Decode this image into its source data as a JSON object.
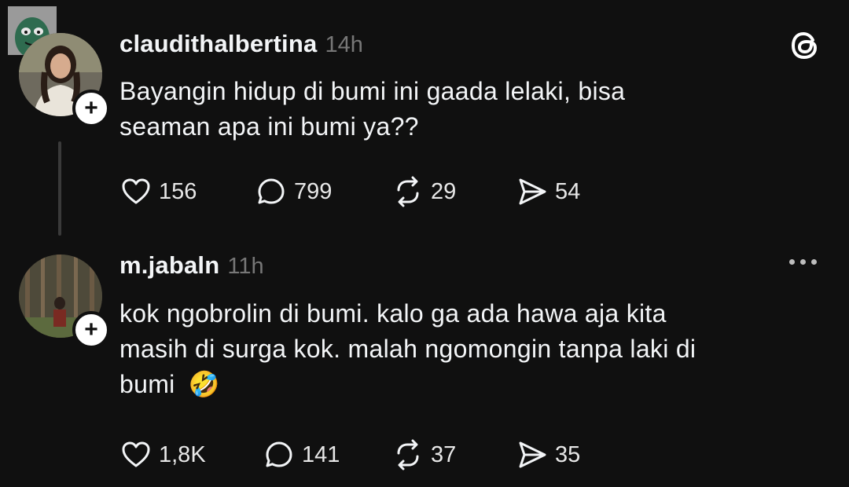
{
  "app": {
    "logo_icon": "threads-logo-icon"
  },
  "posts": [
    {
      "username": "claudithalbertina",
      "time": "14h",
      "text_line1": "Bayangin hidup di bumi ini gaada lelaki, bisa",
      "text_line2": "seaman apa ini bumi ya??",
      "likes": "156",
      "replies": "799",
      "reposts": "29",
      "shares": "54"
    },
    {
      "username": "m.jabaln",
      "time": "11h",
      "text_line1": "kok ngobrolin di bumi. kalo ga ada hawa aja kita",
      "text_line2": "masih di surga kok. malah ngomongin tanpa laki di",
      "text_line3": "bumi",
      "emoji": "🤣",
      "likes": "1,8K",
      "replies": "141",
      "reposts": "37",
      "shares": "35"
    }
  ],
  "colors": {
    "background": "#101010",
    "text": "#f3f5f7",
    "muted": "#777777"
  }
}
